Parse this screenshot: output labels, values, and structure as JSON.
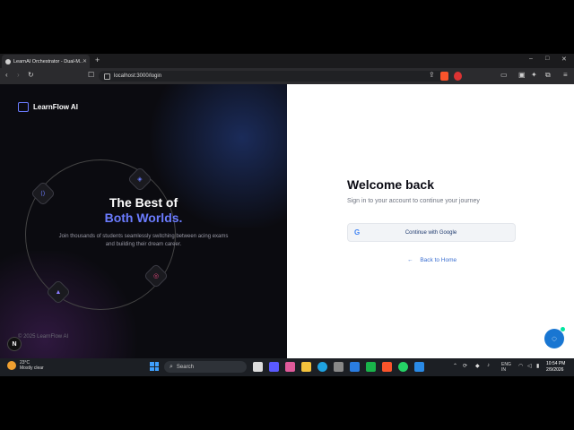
{
  "browser": {
    "tab_title": "LearnAI Orchestrator - Dual-M...",
    "url": "localhost:3000/login",
    "window_controls": [
      "–",
      "□",
      "✕"
    ]
  },
  "hero": {
    "brand": "LearnFlow AI",
    "headline_line1": "The Best of",
    "headline_line2": "Both Worlds.",
    "description": "Join thousands of students seamlessly switching between acing exams and building their dream career.",
    "copyright": "© 2025 LearnFlow AI",
    "badge": "N",
    "accent_color": "#6b7cff"
  },
  "login": {
    "title": "Welcome back",
    "subtitle": "Sign in to your account to continue your journey",
    "google_label": "Continue with Google",
    "google_icon": "G",
    "back_label": "Back to Home",
    "back_arrow": "←"
  },
  "taskbar": {
    "weather_temp": "23°C",
    "weather_desc": "Mostly clear",
    "search_label": "Search",
    "lang_line1": "ENG",
    "lang_line2": "IN",
    "time": "10:54 PM",
    "date": "2/9/2026"
  }
}
